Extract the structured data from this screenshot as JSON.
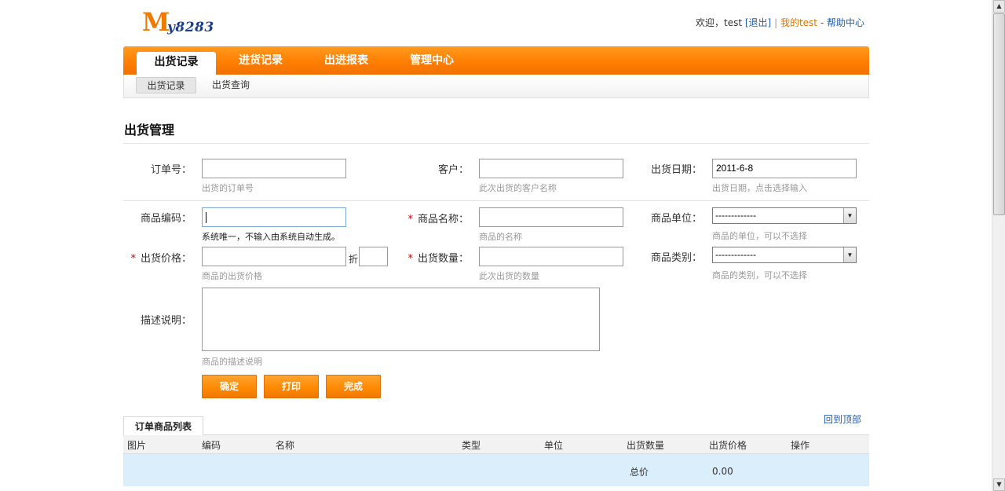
{
  "header": {
    "logo_letter": "M",
    "logo_rest": "y8283",
    "welcome": "欢迎，test",
    "logout": "[退出]",
    "separator": "|",
    "my_account": "我的test",
    "dash": "-",
    "help": "帮助中心"
  },
  "nav": {
    "tabs": [
      {
        "label": "出货记录",
        "active": true
      },
      {
        "label": "进货记录",
        "active": false
      },
      {
        "label": "出进报表",
        "active": false
      },
      {
        "label": "管理中心",
        "active": false
      }
    ],
    "sub": [
      {
        "label": "出货记录",
        "active": true
      },
      {
        "label": "出货查询",
        "active": false
      }
    ]
  },
  "page_title": "出货管理",
  "form": {
    "order_no": {
      "label": "订单号：",
      "value": "",
      "hint": "出货的订单号"
    },
    "customer": {
      "label": "客户：",
      "value": "",
      "hint": "此次出货的客户名称"
    },
    "ship_date": {
      "label": "出货日期：",
      "value": "2011-6-8",
      "hint": "出货日期，点击选择输入"
    },
    "product_code": {
      "label": "商品编码：",
      "value": "",
      "hint": "系统唯一，不输入由系统自动生成。"
    },
    "product_name": {
      "label": "商品名称：",
      "required": "*",
      "value": "",
      "hint": "商品的名称"
    },
    "product_unit": {
      "label": "商品单位：",
      "selected": "-------------",
      "hint": "商品的单位，可以不选择"
    },
    "ship_price": {
      "label": "出货价格：",
      "required": "*",
      "value": "",
      "discount_label": "折",
      "discount_value": "",
      "hint": "商品的出货价格"
    },
    "ship_qty": {
      "label": "出货数量：",
      "required": "*",
      "value": "",
      "hint": "此次出货的数量"
    },
    "product_category": {
      "label": "商品类别：",
      "selected": "-------------",
      "hint": "商品的类别，可以不选择"
    },
    "description": {
      "label": "描述说明：",
      "value": "",
      "hint": "商品的描述说明"
    }
  },
  "buttons": {
    "confirm": "确定",
    "print": "打印",
    "finish": "完成"
  },
  "list": {
    "tab_label": "订单商品列表",
    "back_to_top": "回到顶部",
    "columns": [
      "图片",
      "编码",
      "名称",
      "类型",
      "单位",
      "出货数量",
      "出货价格",
      "操作"
    ],
    "total_label": "总价",
    "total_value": "0.00"
  }
}
